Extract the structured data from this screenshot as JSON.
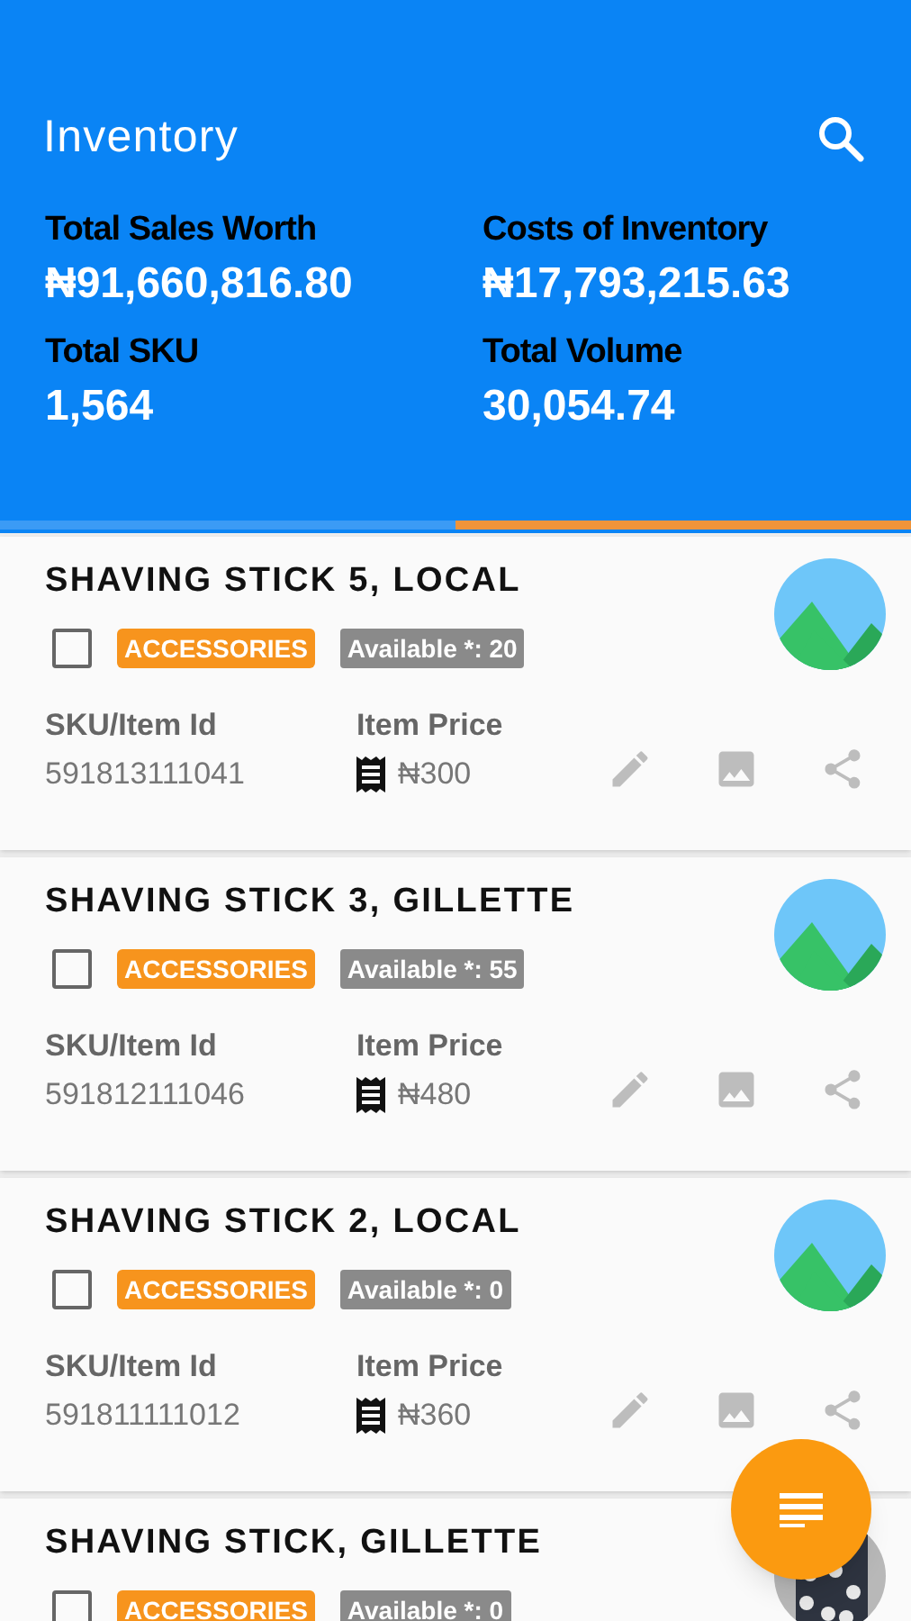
{
  "app_bar": {
    "title": "Inventory"
  },
  "stats": [
    {
      "label": "Total Sales Worth",
      "value": "₦91,660,816.80"
    },
    {
      "label": "Costs of Inventory",
      "value": "₦17,793,215.63"
    },
    {
      "label": "Total SKU",
      "value": "1,564"
    },
    {
      "label": "Total Volume",
      "value": "30,054.74"
    }
  ],
  "tabs": [
    {
      "selected": false
    },
    {
      "selected": true
    }
  ],
  "items": [
    {
      "name": "SHAVING STICK 5, LOCAL",
      "checked": false,
      "category": "ACCESSORIES",
      "availability": "Available *: 20",
      "sku_label": "SKU/Item Id",
      "sku": "591813111041",
      "price_label": "Item Price",
      "price": "₦300",
      "image": {
        "kind": "placeholder"
      }
    },
    {
      "name": "SHAVING STICK 3, GILLETTE",
      "checked": false,
      "category": "ACCESSORIES",
      "availability": "Available *: 55",
      "sku_label": "SKU/Item Id",
      "sku": "591812111046",
      "price_label": "Item Price",
      "price": "₦480",
      "image": {
        "kind": "placeholder"
      }
    },
    {
      "name": "SHAVING STICK 2, LOCAL",
      "checked": false,
      "category": "ACCESSORIES",
      "availability": "Available *: 0",
      "sku_label": "SKU/Item Id",
      "sku": "591811111012",
      "price_label": "Item Price",
      "price": "₦360",
      "image": {
        "kind": "placeholder"
      }
    },
    {
      "name": "SHAVING STICK, GILLETTE",
      "checked": false,
      "category": "ACCESSORIES",
      "availability": "Available *: 0"
    }
  ]
}
